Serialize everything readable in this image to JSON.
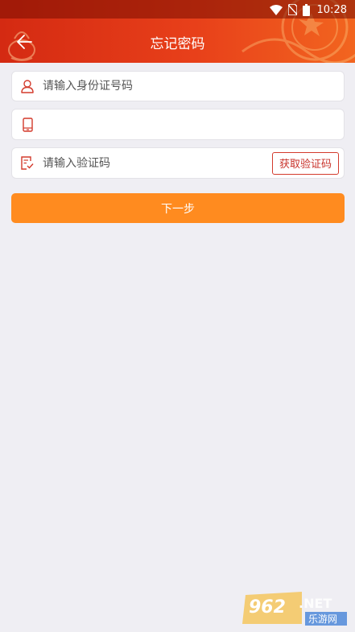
{
  "status_bar": {
    "time": "10:28",
    "icons": [
      "wifi-icon",
      "no-sim-icon",
      "battery-icon"
    ]
  },
  "header": {
    "title": "忘记密码",
    "back_icon": "arrow-left-icon"
  },
  "form": {
    "id_card": {
      "placeholder": "请输入身份证号码",
      "value": "",
      "icon": "user-icon"
    },
    "phone": {
      "placeholder": "",
      "value": "",
      "icon": "phone-icon"
    },
    "code": {
      "placeholder": "请输入验证码",
      "value": "",
      "icon": "form-check-icon",
      "button_label": "获取验证码"
    }
  },
  "next_button": {
    "label": "下一步"
  },
  "watermark": {
    "text_top": "962.NET",
    "text_bottom": "乐游网"
  },
  "colors": {
    "header": "#e8401a",
    "accent": "#ff8b1f",
    "icon_red": "#d33a2c",
    "background": "#efeef3"
  }
}
